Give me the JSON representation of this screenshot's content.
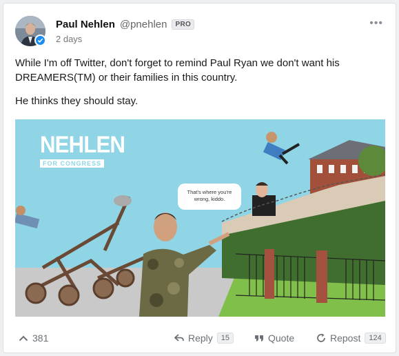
{
  "post": {
    "author_name": "Paul Nehlen",
    "author_handle": "@pnehlen",
    "badge": "PRO",
    "timestamp": "2 days",
    "more_icon": "more-dots-icon",
    "verified_icon": "verified-check-icon",
    "paragraphs": [
      "While I'm off Twitter, don't forget to remind Paul Ryan we don't want his DREAMERS(TM) or their families in this country.",
      "He thinks they should stay."
    ]
  },
  "image": {
    "logo_main": "NEHLEN",
    "logo_sub": "FOR CONGRESS",
    "speech_line1": "That's where you're",
    "speech_line2": "wrong, kiddo.",
    "background_color": "#8fd5e6"
  },
  "actions": {
    "upvote_icon": "chevron-up-icon",
    "upvote_count": "381",
    "reply_label": "Reply",
    "reply_count": "15",
    "quote_label": "Quote",
    "repost_label": "Repost",
    "repost_count": "124"
  },
  "colors": {
    "verified": "#1d8cf0",
    "sky": "#8fd5e6",
    "wall": "#d9cbb5"
  }
}
